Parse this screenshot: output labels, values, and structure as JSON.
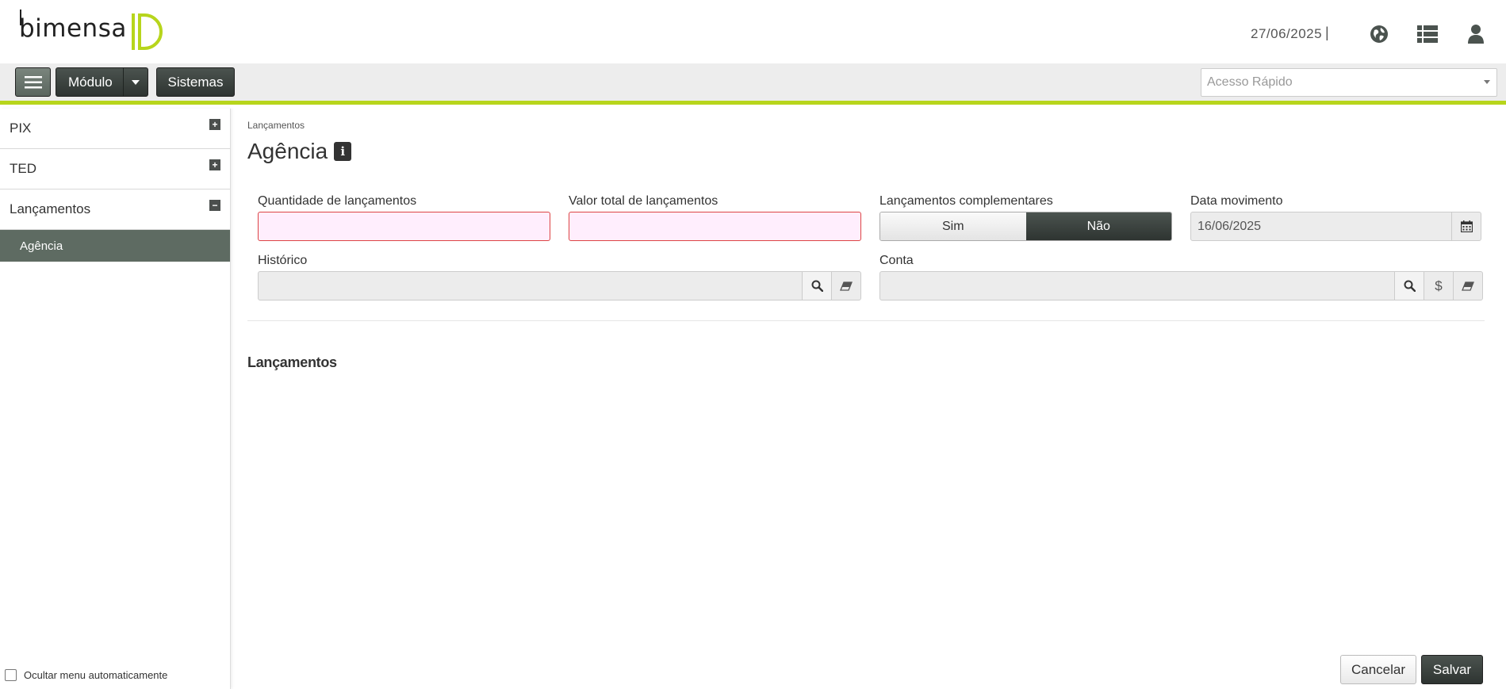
{
  "header": {
    "logo_text": "bimensa",
    "date": "27/06/2025",
    "separator": "|",
    "icons": [
      "globe-icon",
      "list-icon",
      "user-icon"
    ]
  },
  "toolbar": {
    "modulo_label": "Módulo",
    "sistemas_label": "Sistemas",
    "quick_access_placeholder": "Acesso Rápido"
  },
  "sidebar": {
    "items": [
      {
        "label": "PIX",
        "toggle": "+"
      },
      {
        "label": "TED",
        "toggle": "+"
      },
      {
        "label": "Lançamentos",
        "toggle": "−"
      }
    ],
    "active_sub_item": "Agência",
    "auto_hide_label": "Ocultar menu automaticamente"
  },
  "main": {
    "breadcrumb": "Lançamentos",
    "title": "Agência",
    "info_glyph": "i",
    "fields": {
      "quantidade_label": "Quantidade de lançamentos",
      "quantidade_value": "",
      "valor_label": "Valor total de lançamentos",
      "valor_value": "",
      "complementares_label": "Lançamentos complementares",
      "complementares_options": [
        "Sim",
        "Não"
      ],
      "complementares_selected": "Não",
      "data_label": "Data movimento",
      "data_value": "16/06/2025",
      "historico_label": "Histórico",
      "historico_value": "",
      "conta_label": "Conta",
      "conta_value": "",
      "conta_currency_glyph": "$"
    },
    "section_title": "Lançamentos",
    "cancel_label": "Cancelar",
    "save_label": "Salvar"
  },
  "colors": {
    "accent": "#b7d51c",
    "dark_button": "#2e3431",
    "active_sidebar": "#5e6b62",
    "invalid_border": "#dd4444",
    "invalid_bg": "#ffeefd"
  }
}
